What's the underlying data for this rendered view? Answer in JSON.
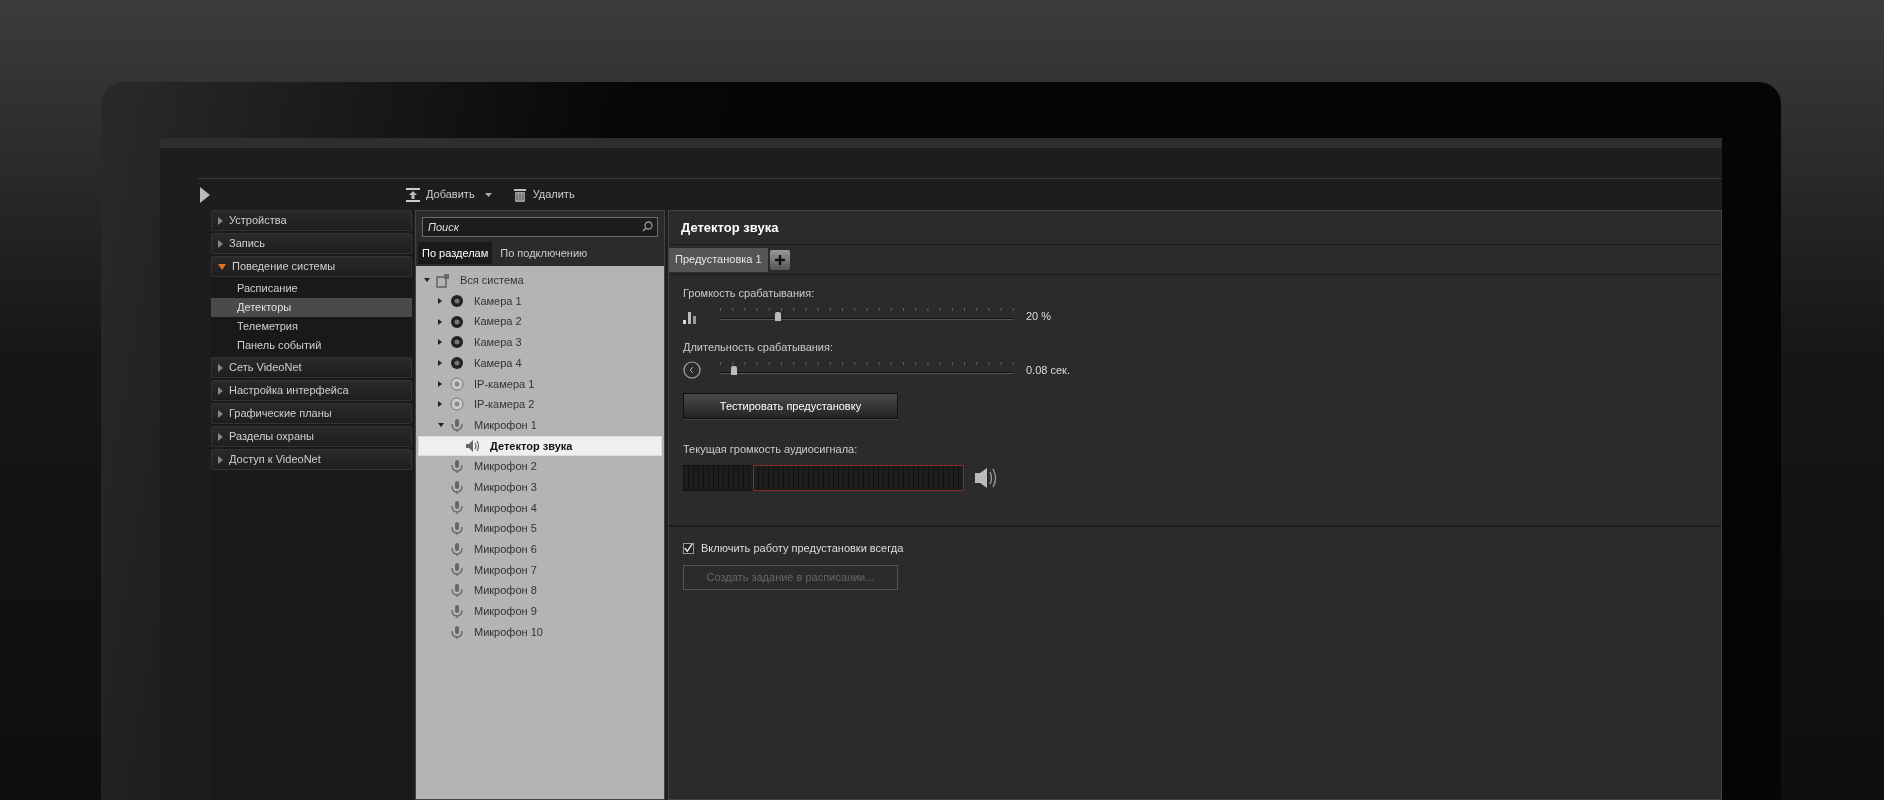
{
  "toolbar": {
    "buttons": [
      {
        "label": "Добавить",
        "kind": "add",
        "dropdown": true
      },
      {
        "label": "Удалить",
        "kind": "delete",
        "dropdown": false
      }
    ]
  },
  "sidebar": {
    "sections": [
      {
        "label": "Устройства",
        "expanded": false
      },
      {
        "label": "Запись",
        "expanded": false
      },
      {
        "label": "Поведение системы",
        "expanded": true,
        "children": [
          {
            "label": "Расписание",
            "selected": false
          },
          {
            "label": "Детекторы",
            "selected": true
          },
          {
            "label": "Телеметрия",
            "selected": false
          },
          {
            "label": "Панель событий",
            "selected": false
          }
        ]
      },
      {
        "label": "Сеть VideoNet",
        "expanded": false
      },
      {
        "label": "Настройка интерфейса",
        "expanded": false
      },
      {
        "label": "Графические планы",
        "expanded": false
      },
      {
        "label": "Разделы охраны",
        "expanded": false
      },
      {
        "label": "Доступ к VideoNet",
        "expanded": false
      }
    ]
  },
  "search": {
    "placeholder": "Поиск"
  },
  "tree_tabs": [
    {
      "label": "По разделам",
      "selected": true
    },
    {
      "label": "По подключению",
      "selected": false
    }
  ],
  "tree": [
    {
      "label": "Вся система",
      "kind": "system",
      "expanded": true,
      "selected": false,
      "children": [
        {
          "label": "Камера 1",
          "kind": "camera",
          "expanded": false,
          "selected": false
        },
        {
          "label": "Камера 2",
          "kind": "camera",
          "expanded": false,
          "selected": false
        },
        {
          "label": "Камера 3",
          "kind": "camera",
          "expanded": false,
          "selected": false
        },
        {
          "label": "Камера 4",
          "kind": "camera",
          "expanded": false,
          "selected": false
        },
        {
          "label": "IP-камера 1",
          "kind": "ipcamera",
          "expanded": false,
          "selected": false
        },
        {
          "label": "IP-камера 2",
          "kind": "ipcamera",
          "expanded": false,
          "selected": false
        },
        {
          "label": "Микрофон 1",
          "kind": "microphone",
          "expanded": true,
          "selected": false,
          "children": [
            {
              "label": "Детектор звука",
              "kind": "detector",
              "selected": true
            }
          ]
        },
        {
          "label": "Микрофон 2",
          "kind": "microphone",
          "selected": false
        },
        {
          "label": "Микрофон 3",
          "kind": "microphone",
          "selected": false
        },
        {
          "label": "Микрофон 4",
          "kind": "microphone",
          "selected": false
        },
        {
          "label": "Микрофон 5",
          "kind": "microphone",
          "selected": false
        },
        {
          "label": "Микрофон 6",
          "kind": "microphone",
          "selected": false
        },
        {
          "label": "Микрофон 7",
          "kind": "microphone",
          "selected": false
        },
        {
          "label": "Микрофон 8",
          "kind": "microphone",
          "selected": false
        },
        {
          "label": "Микрофон 9",
          "kind": "microphone",
          "selected": false
        },
        {
          "label": "Микрофон 10",
          "kind": "microphone",
          "selected": false
        }
      ]
    }
  ],
  "detail": {
    "title": "Детектор звука",
    "presets": [
      {
        "label": "Предустановка 1",
        "selected": true
      }
    ],
    "settings": [
      {
        "kind": "volume",
        "label": "Громкость срабатывания:",
        "level": 0.2,
        "reading": "20 %"
      },
      {
        "kind": "duration",
        "label": "Длительность срабатывания:",
        "level": 0.05,
        "reading": "0.08 сек."
      }
    ],
    "test_button": "Тестировать предустановку",
    "meter_label": "Текущая громкость аудиосигнала:",
    "always_on": {
      "label": "Включить работу предустановки всегда",
      "checked": true
    },
    "schedule_button": {
      "label": "Создать задание в расписании...",
      "disabled": true
    }
  }
}
